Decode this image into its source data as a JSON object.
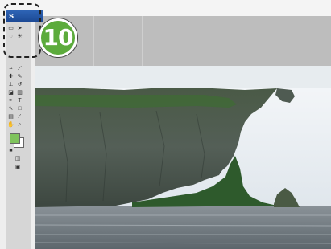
{
  "tools_panel": {
    "title": "s"
  },
  "step_badge": {
    "number": "10"
  },
  "colors": {
    "foreground_swatch": "#7fc35c",
    "background_swatch": "#ffffff",
    "badge": "#5cab3c"
  }
}
